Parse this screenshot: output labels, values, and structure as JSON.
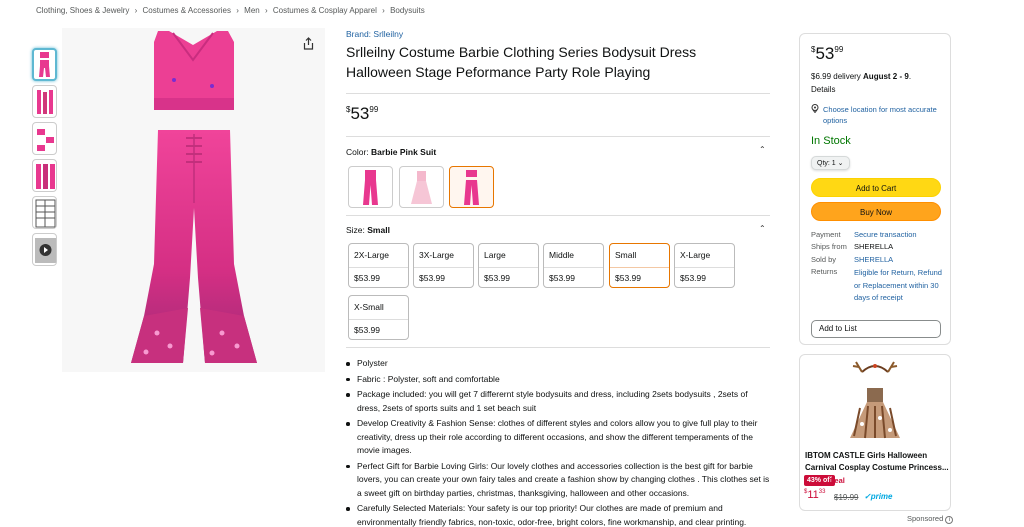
{
  "breadcrumb": [
    "Clothing, Shoes & Jewelry",
    "›",
    "Costumes & Accessories",
    "›",
    "Men",
    "›",
    "Costumes & Cosplay Apparel",
    "›",
    "Bodysuits"
  ],
  "product": {
    "brand": "Brand: Srlleilny",
    "title": "Srlleilny Costume Barbie Clothing Series Bodysuit Dress Halloween Stage Peformance Party Role Playing",
    "price_symbol": "$",
    "price_whole": "53",
    "price_fraction": "99"
  },
  "color": {
    "label": "Color: ",
    "selected": "Barbie Pink Suit",
    "swatches": [
      "jumpsuit",
      "dress",
      "bodysuit-set"
    ]
  },
  "size": {
    "label": "Size: ",
    "selected": "Small",
    "options": [
      {
        "name": "2X-Large",
        "price": "$53.99"
      },
      {
        "name": "3X-Large",
        "price": "$53.99"
      },
      {
        "name": "Large",
        "price": "$53.99"
      },
      {
        "name": "Middle",
        "price": "$53.99"
      },
      {
        "name": "Small",
        "price": "$53.99"
      },
      {
        "name": "X-Large",
        "price": "$53.99"
      },
      {
        "name": "X-Small",
        "price": "$53.99"
      }
    ]
  },
  "bullets": [
    "Polyster",
    "Fabric : Polyster, soft and comfortable",
    "Package included: you will get 7 differernt style bodysuits and dress, including 2sets bodysuits , 2sets of dress, 2sets of sports suits and 1 set beach suit",
    "Develop Creativity & Fashion Sense: clothes of different styles and colors allow you to give full play to their creativity, dress up their role according to different occasions, and show the different temperaments of the movie images.",
    "Perfect Gift for Barbie Loving Girls: Our lovely clothes and accessories collection is the best gift for barbie lovers, you can create your own fairy tales and create a fashion show by changing clothes . This clothes set is a sweet gift on birthday parties, christmas, thanksgiving, halloween and other occasions.",
    "Carefully Selected Materials: Your safety is our top priority! Our clothes are made of premium and environmentally friendly fabrics, non-toxic, odor-free, bright colors, fine workmanship, and clear printing."
  ],
  "buybox": {
    "price_symbol": "$",
    "price_whole": "53",
    "price_fraction": "99",
    "delivery_prefix": "$6.99 delivery ",
    "delivery_dates": "August 2 - 9",
    "delivery_suffix": ".",
    "details": "Details",
    "location": "Choose location for most accurate options",
    "stock": "In Stock",
    "qty": "Qty: 1",
    "add_to_cart": "Add to Cart",
    "buy_now": "Buy Now",
    "payment_label": "Payment",
    "payment_value": "Secure transaction",
    "ships_label": "Ships from",
    "ships_value": "SHERELLA",
    "sold_label": "Sold by",
    "sold_value": "SHERELLA",
    "returns_label": "Returns",
    "returns_value": "Eligible for Return, Refund or Replacement within 30 days of receipt",
    "add_to_list": "Add to List"
  },
  "ad": {
    "title": "IBTOM CASTLE Girls Halloween Carnival Cosplay Costume Princess...",
    "badge": "43% off",
    "deal": "Deal",
    "price_symbol": "$",
    "price_whole": "11",
    "price_fraction": "33",
    "list_price": "$19.99",
    "prime": "✓prime",
    "sponsored": "Sponsored"
  },
  "colors": {
    "link": "#2162a1",
    "in_stock": "#007600",
    "add_to_cart": "#ffd814",
    "buy_now": "#ffa41c",
    "selected_border": "#e77600",
    "deal": "#cc0c39",
    "pink": "#e8388f"
  }
}
